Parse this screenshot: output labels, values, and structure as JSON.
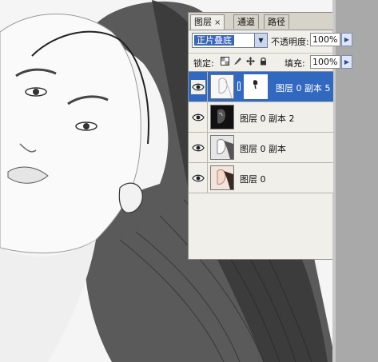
{
  "panel": {
    "tabs": [
      {
        "label": "图层",
        "active": true,
        "close": "×"
      },
      {
        "label": "通道",
        "active": false
      },
      {
        "label": "路径",
        "active": false
      }
    ],
    "blend_mode": "正片叠底",
    "opacity_label": "不透明度:",
    "opacity_value": "100%",
    "lock_label": "锁定:",
    "fill_label": "填充:",
    "fill_value": "100%",
    "lock_icons": [
      "lock-transparency-icon",
      "lock-pixels-icon",
      "lock-position-icon",
      "lock-all-icon"
    ]
  },
  "layers": [
    {
      "name": "图层 0 副本 5",
      "selected": true,
      "visible": true,
      "has_mask": true
    },
    {
      "name": "图层 0 副本 2",
      "selected": false,
      "visible": true,
      "has_mask": false
    },
    {
      "name": "图层 0 副本",
      "selected": false,
      "visible": true,
      "has_mask": false
    },
    {
      "name": "图层 0",
      "selected": false,
      "visible": true,
      "has_mask": false
    }
  ],
  "colors": {
    "selection": "#3269c0",
    "panel_bg": "#f0efea",
    "canvas_gutter": "#a9a9a9"
  }
}
